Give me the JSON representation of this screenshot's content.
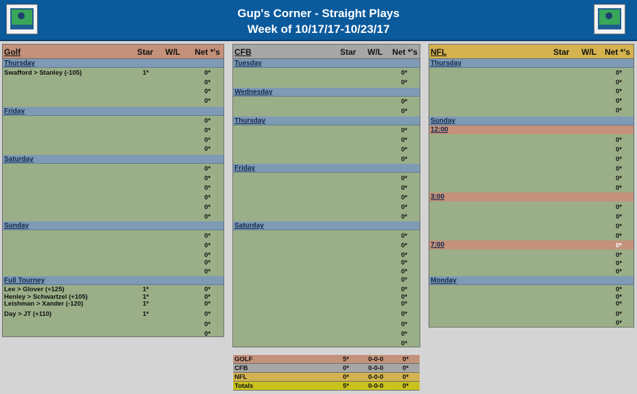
{
  "header": {
    "title_line1": "Gup's Corner - Straight Plays",
    "title_line2": "Week of 10/17/17-10/23/17",
    "accent": "#0a5a9c"
  },
  "columns": {
    "star": "Star",
    "wl": "W/L",
    "net": "Net *'s"
  },
  "golf": {
    "title": "Golf",
    "color": "#c4917a",
    "sections": {
      "thursday": "Thursday",
      "friday": "Friday",
      "saturday": "Saturday",
      "sunday": "Sunday",
      "full": "Full Tourney"
    },
    "thursday_pick": {
      "text": "Swafford > Stanley (-105)",
      "star": "1*"
    },
    "full_picks": [
      {
        "text": "Lee > Glover (+125)",
        "star": "1*"
      },
      {
        "text": "Henley > Schwartzel (+105)",
        "star": "1*"
      },
      {
        "text": "Leishman > Xander (-120)",
        "star": "1*"
      },
      {
        "text": "Day > JT (+110)",
        "star": "1*"
      }
    ],
    "zero": "0*"
  },
  "cfb": {
    "title": "CFB",
    "color": "#a6a6a6",
    "sections": {
      "tuesday": "Tuesday",
      "wednesday": "Wednesday",
      "thursday": "Thursday",
      "friday": "Friday",
      "saturday": "Saturday"
    },
    "zero": "0*"
  },
  "nfl": {
    "title": "NFL",
    "color": "#d4b24f",
    "sections": {
      "thursday": "Thursday",
      "sunday": "Sunday",
      "monday": "Monday"
    },
    "times": {
      "t1": "12:00",
      "t2": "3:00",
      "t3": "7:00"
    },
    "zero": "0*"
  },
  "summary": [
    {
      "label": "GOLF",
      "star": "5*",
      "wl": "0-0-0",
      "net": "0*",
      "color": "#c4917a"
    },
    {
      "label": "CFB",
      "star": "0*",
      "wl": "0-0-0",
      "net": "0*",
      "color": "#a6a6a6"
    },
    {
      "label": "NFL",
      "star": "0*",
      "wl": "0-0-0",
      "net": "0*",
      "color": "#d4b24f"
    },
    {
      "label": "Totals",
      "star": "5*",
      "wl": "0-0-0",
      "net": "0*",
      "color": "#c9c21d"
    }
  ]
}
